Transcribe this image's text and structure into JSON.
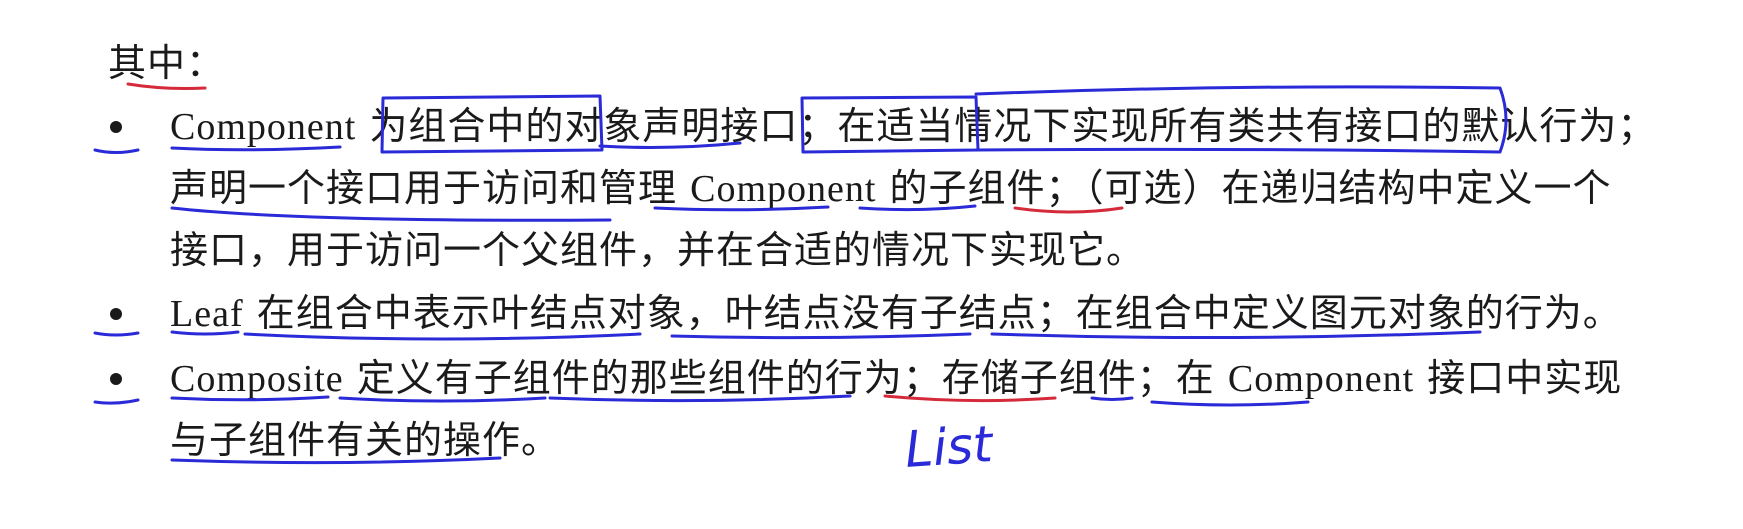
{
  "intro": "其中：",
  "items": [
    {
      "lines": [
        [
          "Component",
          " 为组合中的对象声明接口；在适当情况下实现所有类共有接口的默认行为；"
        ],
        [
          "",
          "声明一个接口用于访问和管理 "
        ],
        [
          "",
          "接口，用于访问一个父组件，并在合适的情况下实现它。"
        ]
      ],
      "line2_term": "Component",
      "line2_rest": " 的子组件；（可选）在递归结构中定义一个"
    },
    {
      "term": "Leaf",
      "text": " 在组合中表示叶结点对象，叶结点没有子结点；在组合中定义图元对象的行为。"
    },
    {
      "term": "Composite",
      "text_a": " 定义有子组件的那些组件的行为；存储子组件；在 ",
      "term2": "Component",
      "text_b": " 接口中实现",
      "cont": "与子组件有关的操作。"
    }
  ],
  "handwriting": "List",
  "ink_colors": {
    "blue": "#2a2ad8",
    "red": "#d42a3a"
  }
}
